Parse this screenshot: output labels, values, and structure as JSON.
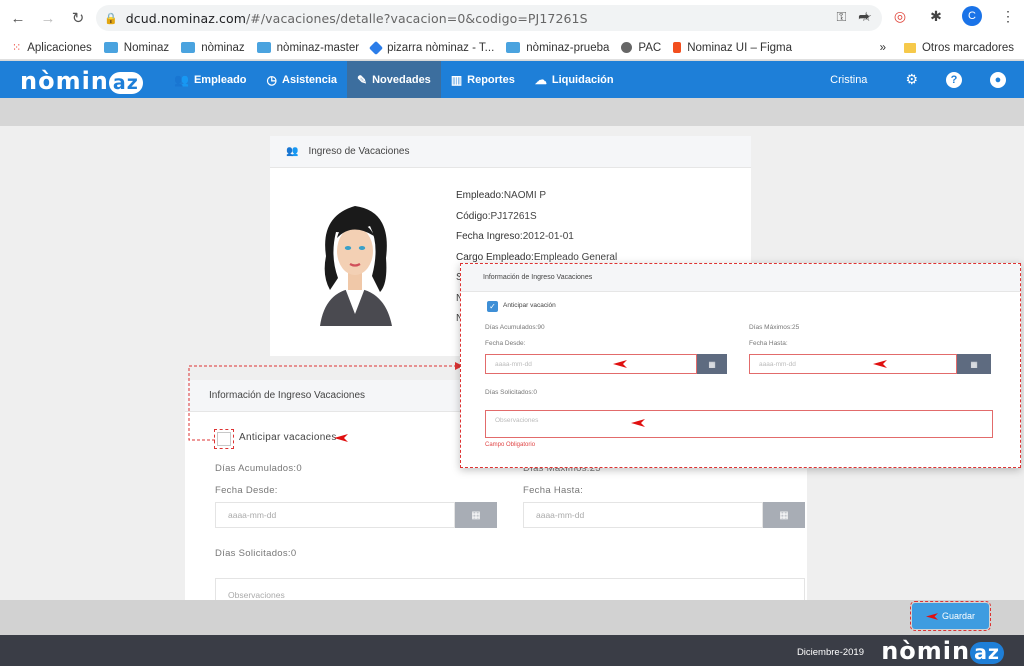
{
  "browser": {
    "url_host": "dcud.nominaz.com",
    "url_path": "/#/vacaciones/detalle?vacacion=0&codigo=PJ17261S",
    "avatar_letter": "C",
    "bookmarks": [
      {
        "label": "Aplicaciones",
        "color": "#ea4335"
      },
      {
        "label": "Nominaz",
        "color": "#4aa3df"
      },
      {
        "label": "nòminaz",
        "color": "#4aa3df"
      },
      {
        "label": "nòminaz-master",
        "color": "#4aa3df"
      },
      {
        "label": "pizarra nòminaz - T...",
        "color": "#2b7de9"
      },
      {
        "label": "nòminaz-prueba",
        "color": "#4aa3df"
      },
      {
        "label": "PAC",
        "color": "#666666"
      },
      {
        "label": "Nominaz UI – Figma",
        "color": "#f24e1e"
      }
    ],
    "more": "»",
    "other_bookmarks": "Otros marcadores"
  },
  "app": {
    "logo_text": "nòmin",
    "logo_badge": "az",
    "nav": [
      {
        "label": "Empleado",
        "icon": "users-icon",
        "glyph": "👥"
      },
      {
        "label": "Asistencia",
        "icon": "clock-icon",
        "glyph": "◷"
      },
      {
        "label": "Novedades",
        "icon": "edit-icon",
        "glyph": "✎"
      },
      {
        "label": "Reportes",
        "icon": "bar-chart-icon",
        "glyph": "▥"
      },
      {
        "label": "Liquidación",
        "icon": "cloud-icon",
        "glyph": "☁"
      }
    ],
    "active_nav": "Novedades",
    "user_name": "Cristina"
  },
  "employee_card": {
    "title": "Ingreso de Vacaciones",
    "fields": [
      {
        "label": "Empleado:",
        "value": "NAOMI P"
      },
      {
        "label": "Código:",
        "value": "PJ17261S"
      },
      {
        "label": "Fecha Ingreso:",
        "value": "2012-01-01"
      },
      {
        "label": "Cargo Empleado:",
        "value": "Empleado General"
      }
    ],
    "partial_labels": [
      "S",
      "N",
      "N"
    ]
  },
  "form": {
    "title": "Información de Ingreso Vacaciones",
    "advance_label": "Anticipar vacaciones",
    "accumulated": "Días Acumulados:0",
    "max_days": "Días Máximos:25",
    "from_label": "Fecha Desde:",
    "to_label": "Fecha Hasta:",
    "date_placeholder": "aaaa-mm-dd",
    "requested": "Días Solicitados:0",
    "observations_placeholder": "Observaciones"
  },
  "zoom": {
    "title": "Información de Ingreso Vacaciones",
    "advance_label": "Anticipar vacación",
    "accumulated": "Días Acumulados:90",
    "max_days": "Días Máximos:25",
    "from_label": "Fecha Desde:",
    "to_label": "Fecha Hasta:",
    "date_placeholder": "aaaa-mm-dd",
    "requested": "Días Solicitados:0",
    "observations_placeholder": "Observaciones",
    "error": "Campo Obligatorio"
  },
  "save_label": "Guardar",
  "footer": {
    "date": "Diciembre-2019",
    "logo_text": "nòmin",
    "logo_badge": "az"
  },
  "colors": {
    "nav_blue": "#1e7fd8",
    "active_nav": "#3c6e9e",
    "annotation_red": "#dd3333",
    "save_blue": "#3e9ce0",
    "footer": "#3a3d46"
  }
}
